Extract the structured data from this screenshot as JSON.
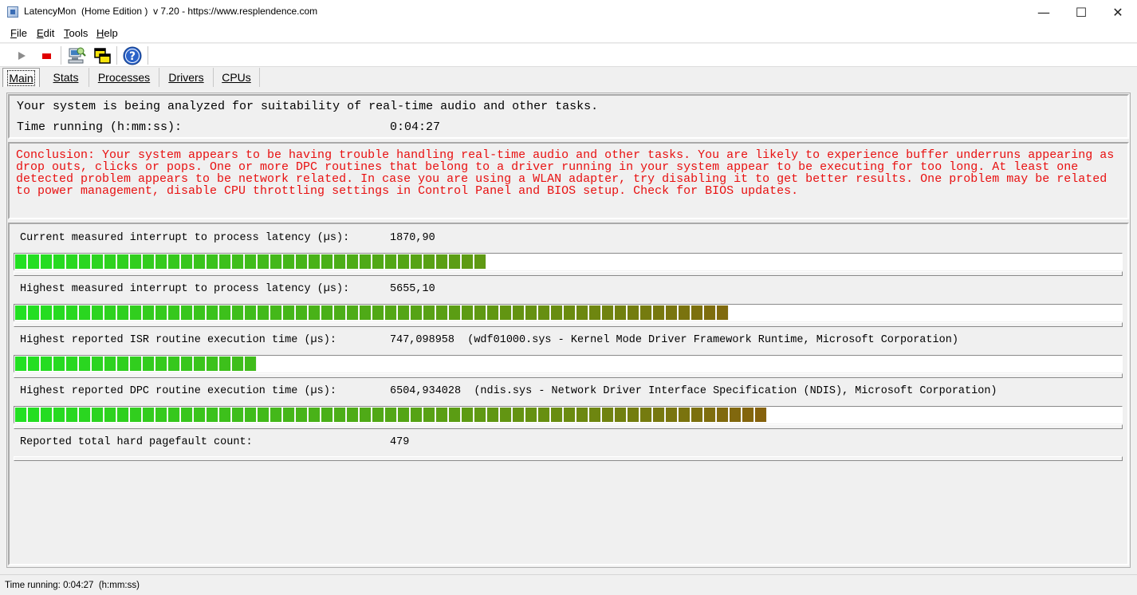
{
  "window": {
    "title": "LatencyMon  (Home Edition )  v 7.20 - https://www.resplendence.com",
    "minimize_glyph": "—",
    "maximize_glyph": "☐",
    "close_glyph": "✕"
  },
  "menu": {
    "items": [
      {
        "key": "F",
        "rest": "ile"
      },
      {
        "key": "E",
        "rest": "dit"
      },
      {
        "key": "T",
        "rest": "ools"
      },
      {
        "key": "H",
        "rest": "elp"
      }
    ]
  },
  "toolbar": {
    "play_icon": "play-icon",
    "stop_icon": "stop-icon",
    "stop_color": "#e00000",
    "help_glyph": "?"
  },
  "tabs": [
    {
      "label": "Main",
      "active": true
    },
    {
      "label": "Stats",
      "active": false
    },
    {
      "label": "Processes",
      "active": false
    },
    {
      "label": "Drivers",
      "active": false
    },
    {
      "label": "CPUs",
      "active": false
    }
  ],
  "summary": {
    "analysis_text": "Your system is being analyzed for suitability of real-time audio and other tasks.",
    "time_label": "Time running (h:mm:ss):",
    "time_value": "0:04:27"
  },
  "conclusion": {
    "text": "Conclusion: Your system appears to be having trouble handling real-time audio and other tasks. You are likely to experience buffer underruns appearing as drop outs, clicks or pops. One or more DPC routines that belong to a driver running in your system appear to be executing for too long. At least one detected problem appears to be network related. In case you are using a WLAN adapter, try disabling it to get better results. One problem may be related to power management, disable CPU throttling settings in Control Panel and BIOS setup. Check for BIOS updates.",
    "color": "#e81010"
  },
  "metrics": [
    {
      "label": "Current measured interrupt to process latency (µs):",
      "value": "1870,90",
      "detail": "",
      "bar_fraction": 0.4244
    },
    {
      "label": "Highest measured interrupt to process latency (µs):",
      "value": "5655,10",
      "detail": "",
      "bar_fraction": 0.6403
    },
    {
      "label": "Highest reported ISR routine execution time (µs):",
      "value": "747,098958",
      "detail": "(wdf01000.sys - Kernel Mode Driver Framework Runtime, Microsoft Corporation)",
      "bar_fraction": 0.2158
    },
    {
      "label": "Highest reported DPC routine execution time (µs):",
      "value": "6504,934028",
      "detail": "(ndis.sys - Network Driver Interface Specification (NDIS), Microsoft Corporation)",
      "bar_fraction": 0.6748
    },
    {
      "label": "Reported total hard pagefault count:",
      "value": "479",
      "detail": "",
      "bar_fraction": 0
    }
  ],
  "bar_colors": {
    "start": "#22e022",
    "mid": "#6b8a10",
    "end": "#b81408"
  },
  "status": {
    "text": "Time running: 0:04:27  (h:mm:ss)"
  }
}
